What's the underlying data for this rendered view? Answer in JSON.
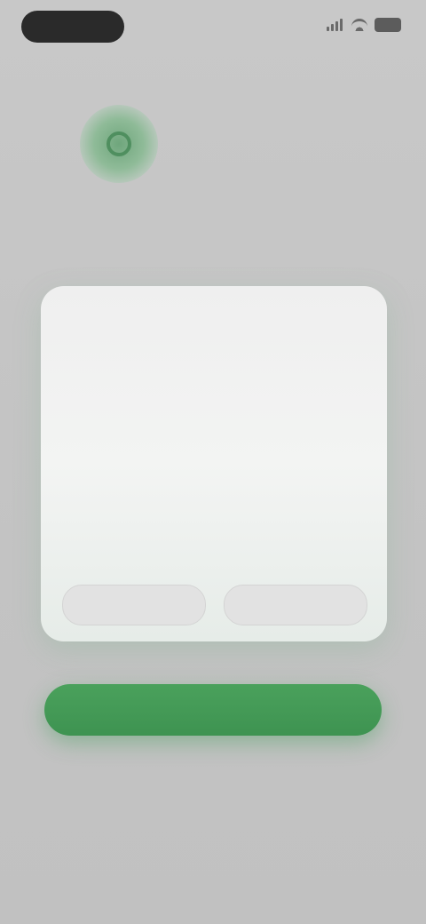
{
  "status_bar": {
    "time": "",
    "icons": [
      "signal-icon",
      "wifi-icon",
      "battery-icon"
    ]
  },
  "header": {
    "title": "",
    "subtitle": "",
    "logo_icon": "logo-icon"
  },
  "intro": {
    "text": ""
  },
  "card": {
    "labels": [
      "",
      ""
    ],
    "values": {
      "left": "",
      "middle": "",
      "right": ""
    },
    "subs": [
      "",
      ""
    ],
    "actions": {
      "left_label": "",
      "right_label": ""
    }
  },
  "primary_button": {
    "label": ""
  },
  "secondary_link": {
    "label": ""
  },
  "colors": {
    "accent": "#45a058",
    "background": "#c4c4c4",
    "card": "#f0f1f0"
  }
}
